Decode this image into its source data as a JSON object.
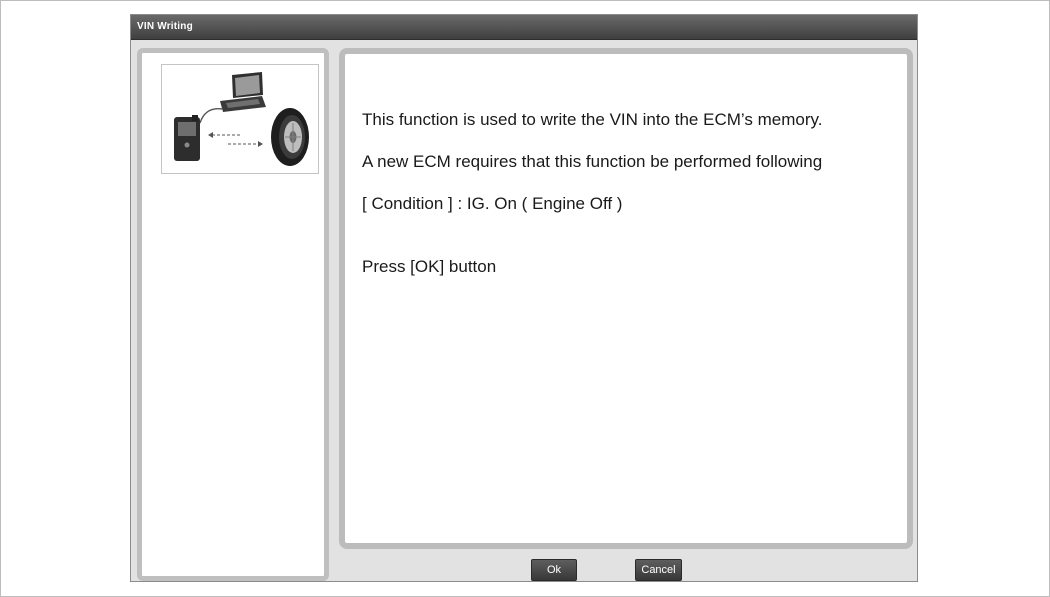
{
  "window": {
    "title": "VIN Writing"
  },
  "illustration": {
    "icons": [
      "laptop-icon",
      "scan-tool-icon",
      "data-transfer-arrows-icon",
      "tire-icon"
    ]
  },
  "message": {
    "line1": "This function is used to write the VIN into the ECM’s memory.",
    "line2": "A new ECM requires that this function be performed following",
    "line3": "[ Condition ] : IG. On ( Engine Off )",
    "line4": "Press [OK] button"
  },
  "buttons": {
    "ok_label": "Ok",
    "cancel_label": "Cancel"
  },
  "colors": {
    "titlebar": "#4a4a4a",
    "panel_border": "#bcbcbc",
    "button": "#444444"
  }
}
